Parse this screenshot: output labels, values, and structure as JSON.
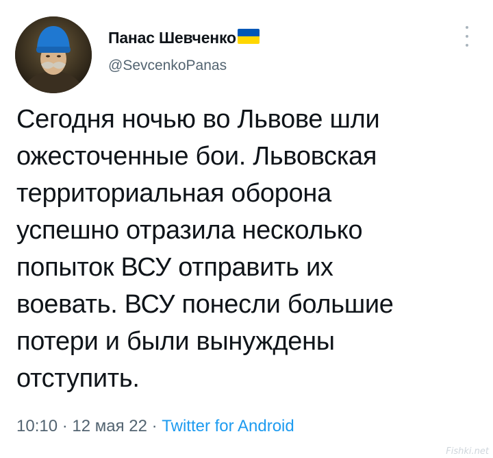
{
  "author": {
    "display_name": "Панас Шевченко",
    "handle": "@SevcenkoPanas",
    "flag": "ukraine-flag-emoji"
  },
  "tweet": {
    "lines": [
      "Сегодня ночью во Львове шли",
      "ожесточенные бои. Львовская",
      "территориальная оборона",
      "успешно отразила несколько",
      "попыток ВСУ отправить их",
      "воевать. ВСУ понесли большие",
      "потери и были вынуждены",
      "отступить."
    ]
  },
  "meta": {
    "time": "10:10",
    "separator1": " · ",
    "date": "12 мая 22",
    "separator2": " · ",
    "source": "Twitter for Android"
  },
  "watermark": "Fishki.net",
  "colors": {
    "text": "#0f1419",
    "secondary": "#536471",
    "link": "#1d9bf0",
    "flag_blue": "#0057b7",
    "flag_yellow": "#ffd700"
  },
  "icons": {
    "more": "more-vertical-icon"
  }
}
